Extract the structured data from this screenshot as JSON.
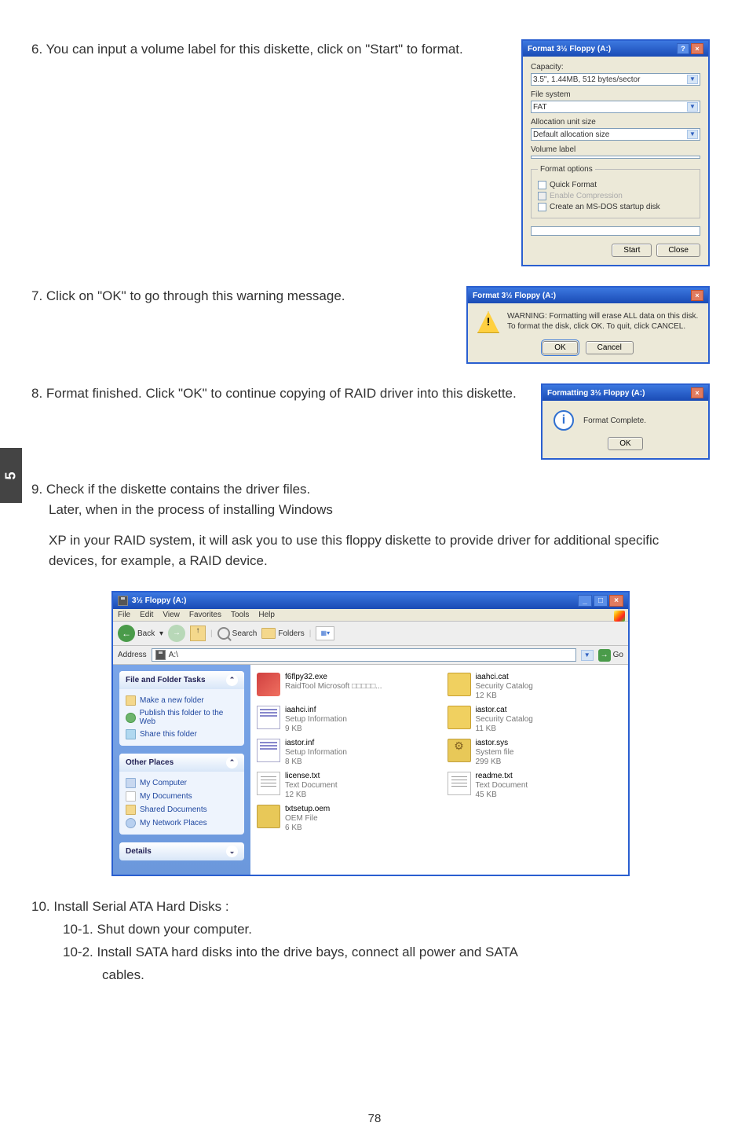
{
  "chapter": "5",
  "page_number": "78",
  "steps": {
    "s6": "6. You can input a volume label for this diskette, click on \"Start\" to format.",
    "s7": "7. Click on \"OK\" to go through this warning message.",
    "s8": "8. Format finished. Click \"OK\" to continue copying of RAID driver into this diskette.",
    "s9a": "9. Check if the diskette contains the driver files.",
    "s9b": "Later, when in the process of installing Windows",
    "s9c": "XP in your RAID system, it will ask you to use this floppy diskette to  provide driver for additional specific devices, for example, a RAID device.",
    "s10": "10. Install Serial ATA Hard Disks :",
    "s10_1": "10-1. Shut down your computer.",
    "s10_2a": "10-2.  Install SATA hard disks into the drive bays, connect all power and SATA",
    "s10_2b": "cables."
  },
  "format_dialog": {
    "title": "Format 3½ Floppy (A:)",
    "capacity_label": "Capacity:",
    "capacity_value": "3.5\", 1.44MB, 512 bytes/sector",
    "fs_label": "File system",
    "fs_value": "FAT",
    "alloc_label": "Allocation unit size",
    "alloc_value": "Default allocation size",
    "vol_label": "Volume label",
    "vol_value": "",
    "options_legend": "Format options",
    "opt_quick": "Quick Format",
    "opt_comp": "Enable Compression",
    "opt_dos": "Create an MS-DOS startup disk",
    "btn_start": "Start",
    "btn_close": "Close"
  },
  "warn_dialog": {
    "title": "Format 3½ Floppy (A:)",
    "line1": "WARNING: Formatting will erase ALL data on this disk.",
    "line2": "To format the disk, click OK. To quit, click CANCEL.",
    "btn_ok": "OK",
    "btn_cancel": "Cancel"
  },
  "info_dialog": {
    "title": "Formatting 3½ Floppy (A:)",
    "text": "Format Complete.",
    "btn_ok": "OK"
  },
  "explorer": {
    "title": "3½ Floppy (A:)",
    "menu": {
      "file": "File",
      "edit": "Edit",
      "view": "View",
      "fav": "Favorites",
      "tools": "Tools",
      "help": "Help"
    },
    "toolbar": {
      "back": "Back",
      "search": "Search",
      "folders": "Folders"
    },
    "address_label": "Address",
    "address_value": "A:\\",
    "go": "Go",
    "sidebar": {
      "tasks": {
        "title": "File and Folder Tasks",
        "items": [
          "Make a new folder",
          "Publish this folder to the Web",
          "Share this folder"
        ]
      },
      "places": {
        "title": "Other Places",
        "items": [
          "My Computer",
          "My Documents",
          "Shared Documents",
          "My Network Places"
        ]
      },
      "details": {
        "title": "Details"
      }
    },
    "files": [
      {
        "name": "f6flpy32.exe",
        "desc": "RaidTool Microsoft □□□□□...",
        "icon": "exe"
      },
      {
        "name": "iaahci.cat",
        "desc": "Security Catalog",
        "size": "12 KB",
        "icon": "cat"
      },
      {
        "name": "iaahci.inf",
        "desc": "Setup Information",
        "size": "9 KB",
        "icon": "inf"
      },
      {
        "name": "iastor.cat",
        "desc": "Security Catalog",
        "size": "11 KB",
        "icon": "cat"
      },
      {
        "name": "iastor.inf",
        "desc": "Setup Information",
        "size": "8 KB",
        "icon": "inf"
      },
      {
        "name": "iastor.sys",
        "desc": "System file",
        "size": "299 KB",
        "icon": "sys"
      },
      {
        "name": "license.txt",
        "desc": "Text Document",
        "size": "12 KB",
        "icon": "txt"
      },
      {
        "name": "readme.txt",
        "desc": "Text Document",
        "size": "45 KB",
        "icon": "txt"
      },
      {
        "name": "txtsetup.oem",
        "desc": "OEM File",
        "size": "6 KB",
        "icon": "oem"
      }
    ]
  }
}
